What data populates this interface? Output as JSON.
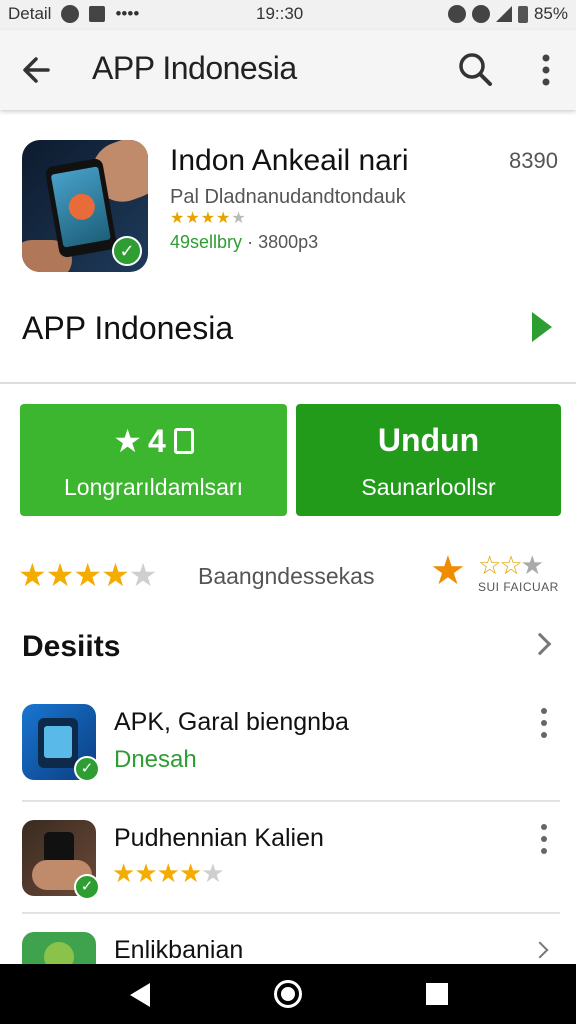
{
  "status_bar": {
    "left_label": "Detail",
    "dots": "••••",
    "time": "19::30",
    "battery": "85%"
  },
  "app_bar": {
    "title": "APP Indonesia"
  },
  "app_header": {
    "name": "Indon Ankeail nari",
    "size": "8390",
    "developer": "Pal Dladnanudandtondauk",
    "mini_rating_stars": 4,
    "downloads_green": "49sellbry",
    "downloads_sep": "·",
    "downloads_count": "3800p3"
  },
  "section": {
    "title": "APP Indonesia"
  },
  "buttons": {
    "rate": {
      "count": "4",
      "label": "Longrarıldamlsarı"
    },
    "install": {
      "title": "Undun",
      "label": "Saunarloollsr"
    }
  },
  "rating_row": {
    "stars_filled": 4,
    "stars_total": 5,
    "label": "Baangndessekas",
    "fav_label": "SUI FAICUAR"
  },
  "details": {
    "title": "Desiits"
  },
  "list": [
    {
      "title": "APK, Garal biengnba",
      "subtitle": "Dnesah"
    },
    {
      "title": "Pudhennian Kalien",
      "stars_filled": 4,
      "stars_total": 5
    },
    {
      "title": "Enlikbanian"
    }
  ],
  "colors": {
    "accent_green": "#3db62f",
    "install_green": "#229a1a",
    "star_gold": "#f4ac00"
  }
}
